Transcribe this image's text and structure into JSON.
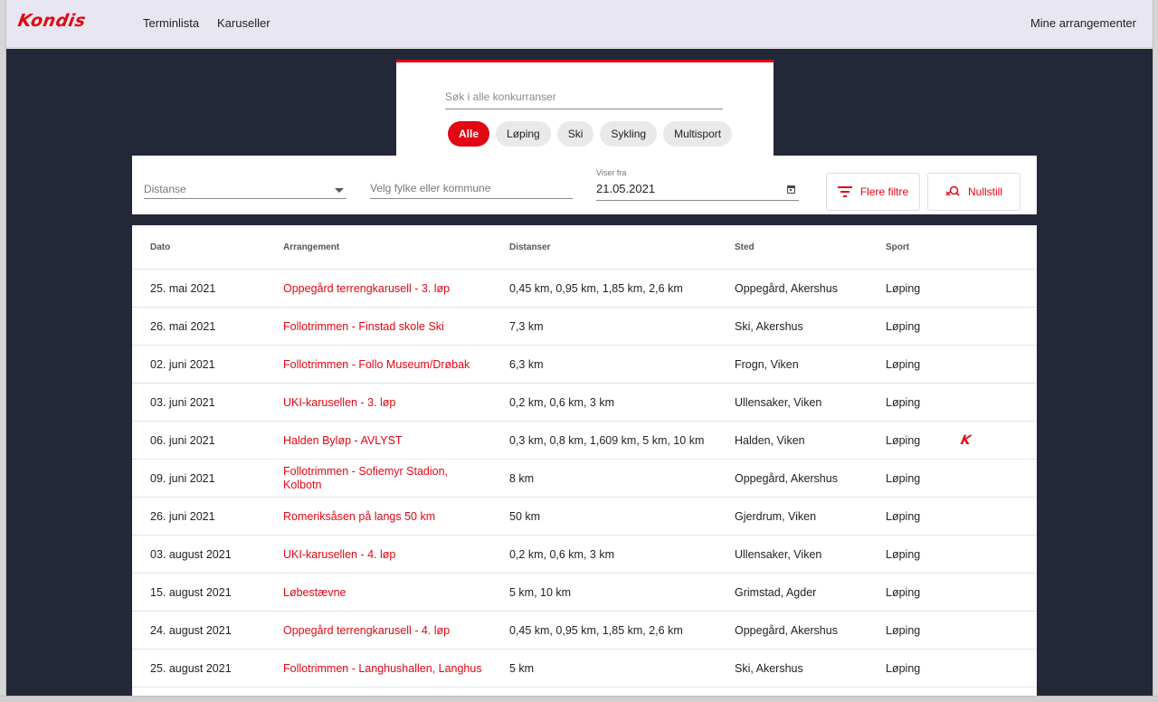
{
  "header": {
    "logo": "Kondis",
    "nav": [
      "Terminlista",
      "Karuseller"
    ],
    "right_link": "Mine arrangementer"
  },
  "search": {
    "placeholder": "Søk i alle konkurranser",
    "chips": [
      {
        "label": "Alle",
        "active": true
      },
      {
        "label": "Løping",
        "active": false
      },
      {
        "label": "Ski",
        "active": false
      },
      {
        "label": "Sykling",
        "active": false
      },
      {
        "label": "Multisport",
        "active": false
      }
    ]
  },
  "filters": {
    "distance_label": "Distanse",
    "region_placeholder": "Velg fylke eller kommune",
    "date_small_label": "Viser fra",
    "date_value": "21.05.2021",
    "more_filters_label": "Flere filtre",
    "reset_label": "Nullstill"
  },
  "table": {
    "headers": [
      "Dato",
      "Arrangement",
      "Distanser",
      "Sted",
      "Sport"
    ],
    "rows": [
      {
        "date": "25. mai 2021",
        "event": "Oppegård terrengkarusell - 3. løp",
        "distances": "0,45 km, 0,95 km, 1,85 km, 2,6 km",
        "place": "Oppegård, Akershus",
        "sport": "Løping",
        "badge": ""
      },
      {
        "date": "26. mai 2021",
        "event": "Follotrimmen - Finstad skole Ski",
        "distances": "7,3 km",
        "place": "Ski, Akershus",
        "sport": "Løping",
        "badge": ""
      },
      {
        "date": "02. juni 2021",
        "event": "Follotrimmen - Follo Museum/Drøbak",
        "distances": "6,3 km",
        "place": "Frogn, Viken",
        "sport": "Løping",
        "badge": ""
      },
      {
        "date": "03. juni 2021",
        "event": "UKI-karusellen - 3. løp",
        "distances": "0,2 km, 0,6 km, 3 km",
        "place": "Ullensaker, Viken",
        "sport": "Løping",
        "badge": ""
      },
      {
        "date": "06. juni 2021",
        "event": "Halden Byløp - AVLYST",
        "distances": "0,3 km, 0,8 km, 1,609 km, 5 km, 10 km",
        "place": "Halden, Viken",
        "sport": "Løping",
        "badge": "K"
      },
      {
        "date": "09. juni 2021",
        "event": "Follotrimmen - Sofiemyr Stadion, Kolbotn",
        "distances": "8 km",
        "place": "Oppegård, Akershus",
        "sport": "Løping",
        "badge": ""
      },
      {
        "date": "26. juni 2021",
        "event": "Romeriksåsen på langs 50 km",
        "distances": "50 km",
        "place": "Gjerdrum, Viken",
        "sport": "Løping",
        "badge": ""
      },
      {
        "date": "03. august 2021",
        "event": "UKI-karusellen - 4. løp",
        "distances": "0,2 km, 0,6 km, 3 km",
        "place": "Ullensaker, Viken",
        "sport": "Løping",
        "badge": ""
      },
      {
        "date": "15. august 2021",
        "event": "Løbestævne",
        "distances": "5 km, 10 km",
        "place": "Grimstad, Agder",
        "sport": "Løping",
        "badge": ""
      },
      {
        "date": "24. august 2021",
        "event": "Oppegård terrengkarusell - 4. løp",
        "distances": "0,45 km, 0,95 km, 1,85 km, 2,6 km",
        "place": "Oppegård, Akershus",
        "sport": "Løping",
        "badge": ""
      },
      {
        "date": "25. august 2021",
        "event": "Follotrimmen - Langhushallen, Langhus",
        "distances": "5 km",
        "place": "Ski, Akershus",
        "sport": "Løping",
        "badge": ""
      }
    ]
  },
  "colors": {
    "accent": "#e30613",
    "background": "#232839",
    "topbar": "#e8e7f1"
  }
}
